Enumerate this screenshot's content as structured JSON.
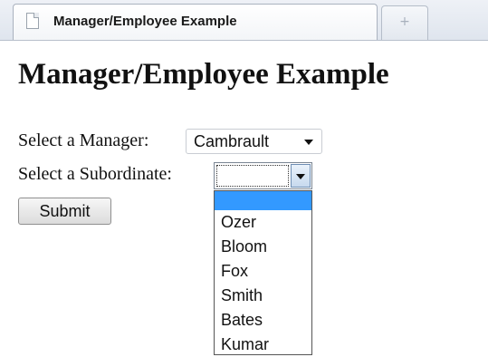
{
  "browser": {
    "tab_title": "Manager/Employee Example",
    "new_tab_symbol": "+"
  },
  "page": {
    "heading": "Manager/Employee Example",
    "manager_label": "Select a Manager:",
    "manager_value": "Cambrault",
    "subordinate_label": "Select a Subordinate:",
    "subordinate_value": "",
    "submit_label": "Submit"
  },
  "dropdown": {
    "options": [
      "",
      "Ozer",
      "Bloom",
      "Fox",
      "Smith",
      "Bates",
      "Kumar"
    ]
  }
}
